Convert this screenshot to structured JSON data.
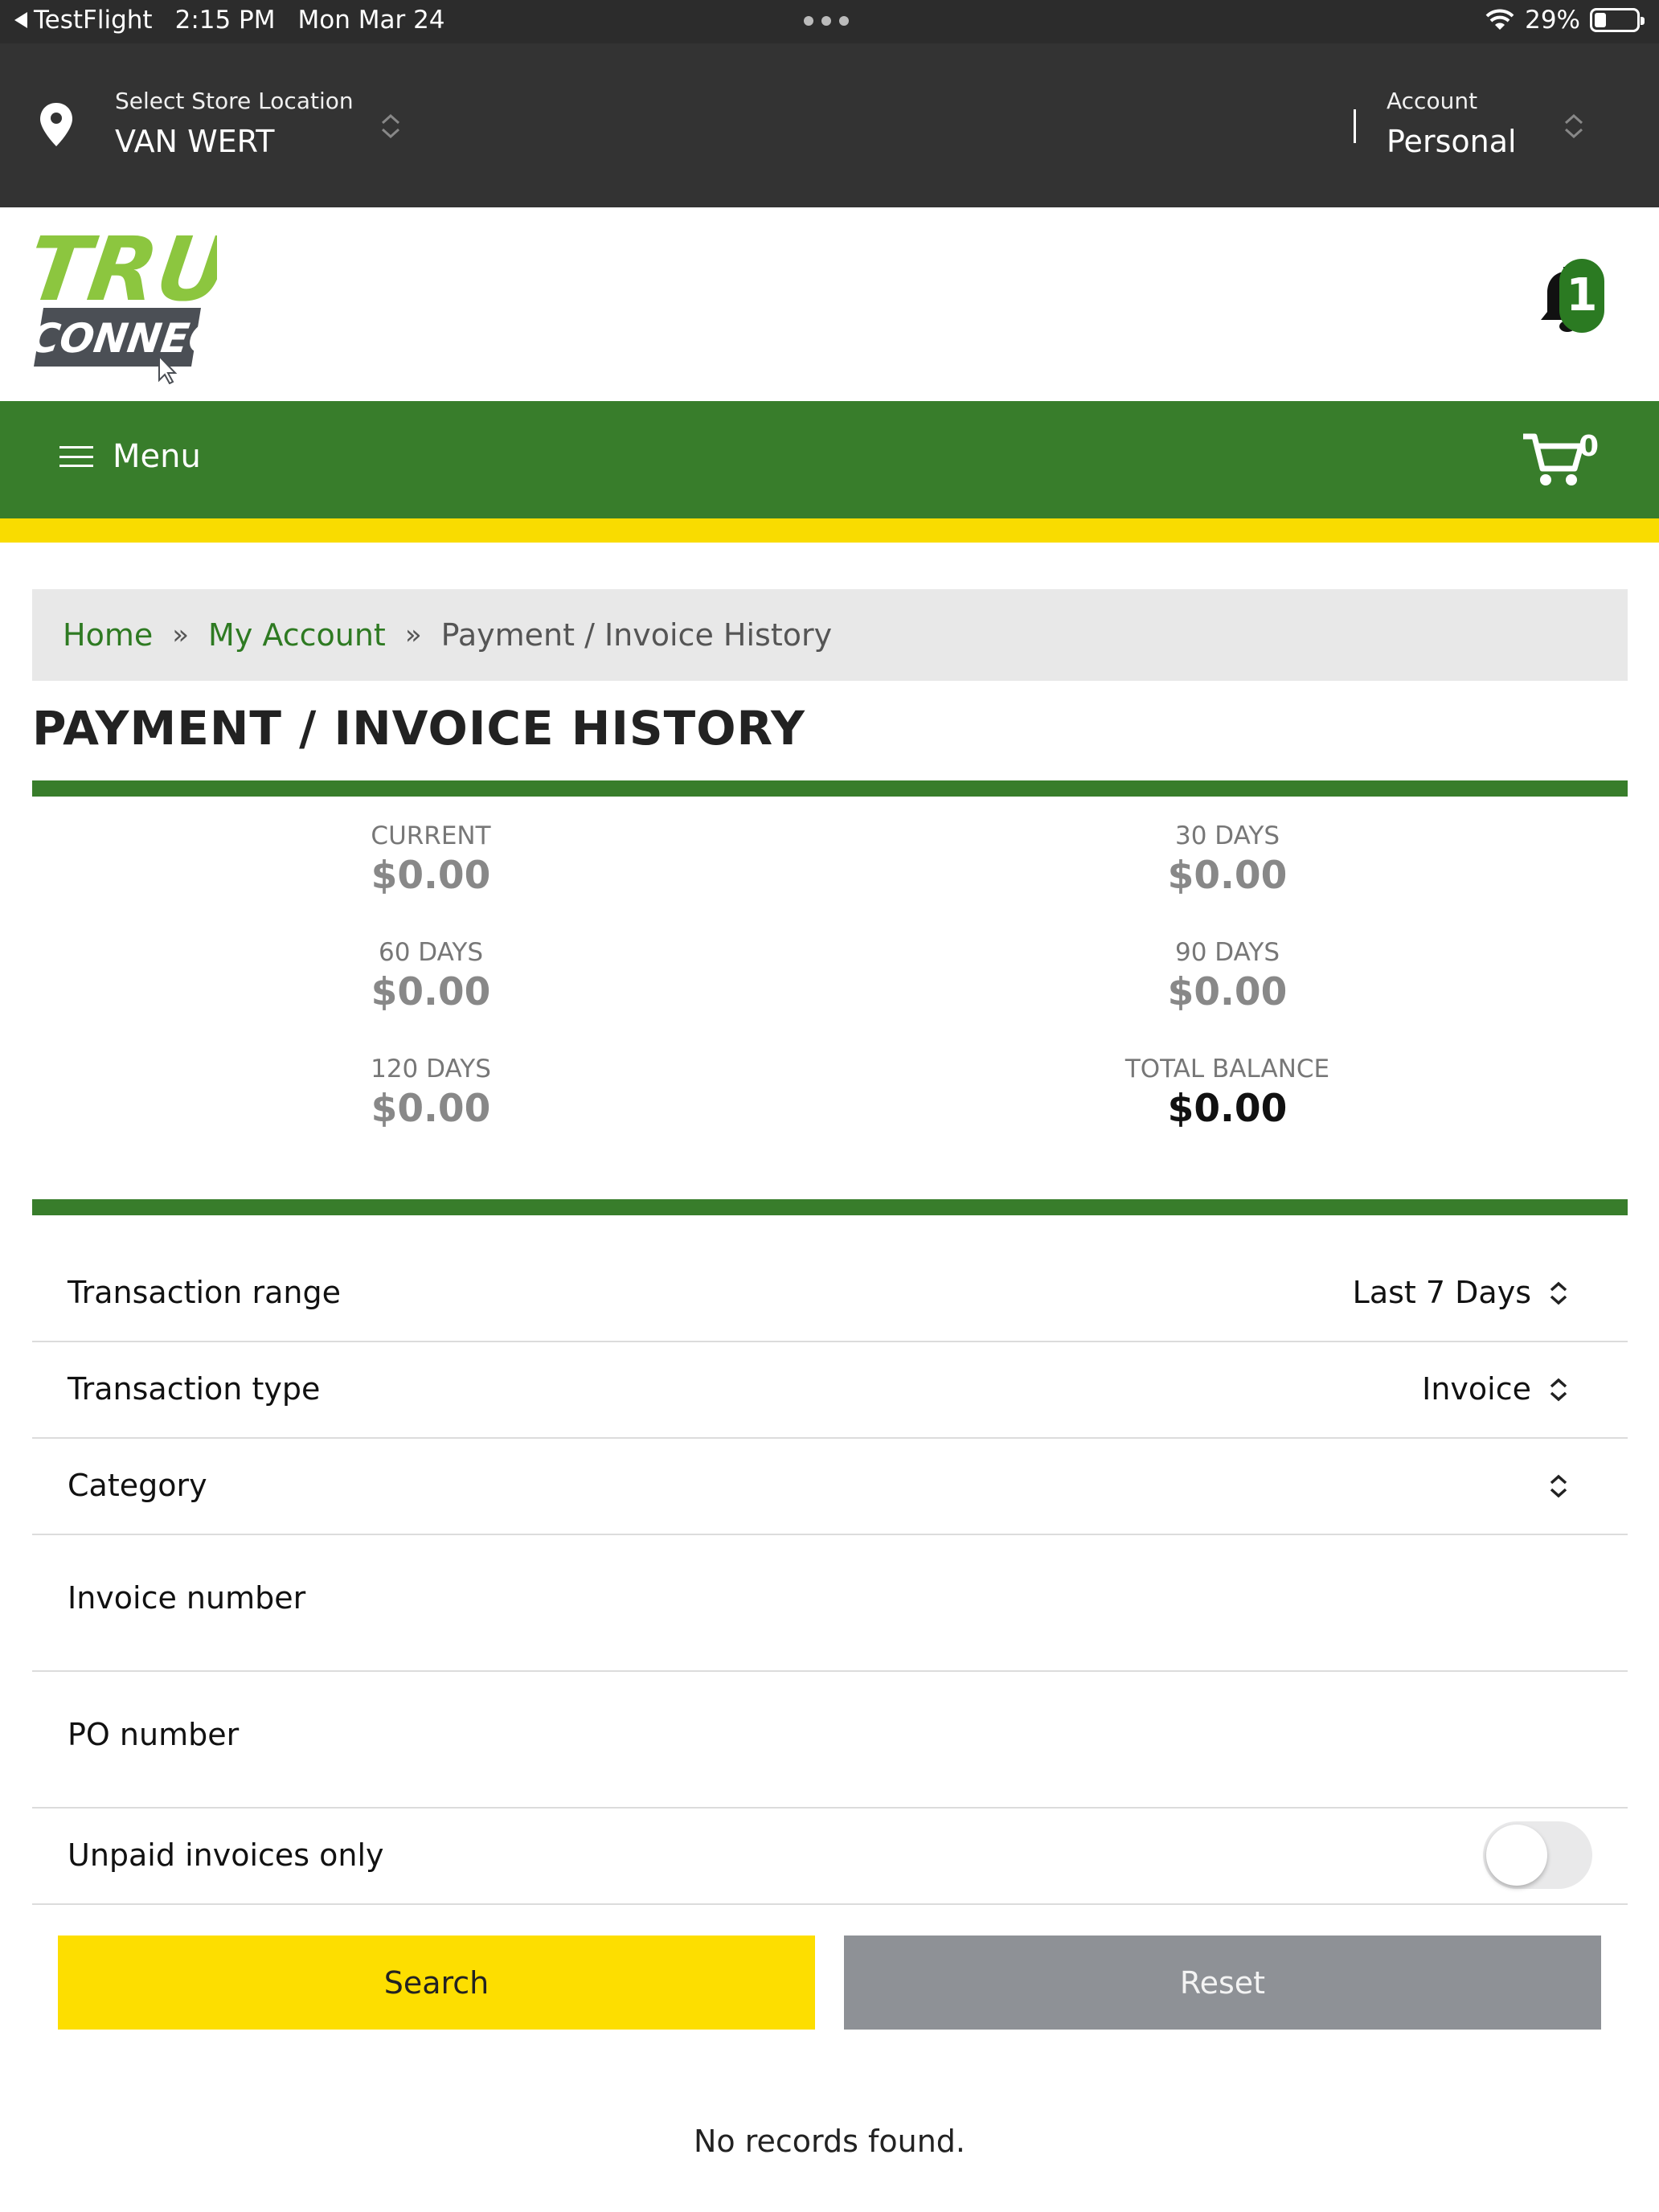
{
  "status_bar": {
    "back_app": "TestFlight",
    "time": "2:15 PM",
    "date": "Mon Mar 24",
    "battery": "29%",
    "battery_level": 0.29
  },
  "header": {
    "store_label": "Select Store Location",
    "store_value": "VAN WERT",
    "account_label": "Account",
    "account_value": "Personal"
  },
  "logo": {
    "line1": "TRU",
    "line2": "CONNECT"
  },
  "notifications": {
    "count": "1"
  },
  "nav": {
    "menu_label": "Menu",
    "cart_count": "0"
  },
  "breadcrumb": {
    "home": "Home",
    "my_account": "My Account",
    "current": "Payment / Invoice History",
    "separator": "»"
  },
  "page_title": "PAYMENT / INVOICE HISTORY",
  "balances": {
    "current": {
      "label": "CURRENT",
      "value": "$0.00"
    },
    "days_30": {
      "label": "30 DAYS",
      "value": "$0.00"
    },
    "days_60": {
      "label": "60 DAYS",
      "value": "$0.00"
    },
    "days_90": {
      "label": "90 DAYS",
      "value": "$0.00"
    },
    "days_120": {
      "label": "120 DAYS",
      "value": "$0.00"
    },
    "total": {
      "label": "TOTAL BALANCE",
      "value": "$0.00"
    }
  },
  "filters": {
    "transaction_range": {
      "label": "Transaction range",
      "value": "Last 7 Days"
    },
    "transaction_type": {
      "label": "Transaction type",
      "value": "Invoice"
    },
    "category": {
      "label": "Category",
      "value": ""
    },
    "invoice_number": {
      "label": "Invoice number"
    },
    "po_number": {
      "label": "PO number"
    },
    "unpaid_only": {
      "label": "Unpaid invoices only",
      "on": false
    }
  },
  "buttons": {
    "search": "Search",
    "reset": "Reset"
  },
  "results": {
    "empty_message": "No records found."
  },
  "colors": {
    "dark_header": "#333333",
    "brand_green": "#387d2b",
    "accent_yellow": "#f9dc00",
    "logo_lime": "#8cc63f",
    "reset_gray": "#8e9196"
  }
}
